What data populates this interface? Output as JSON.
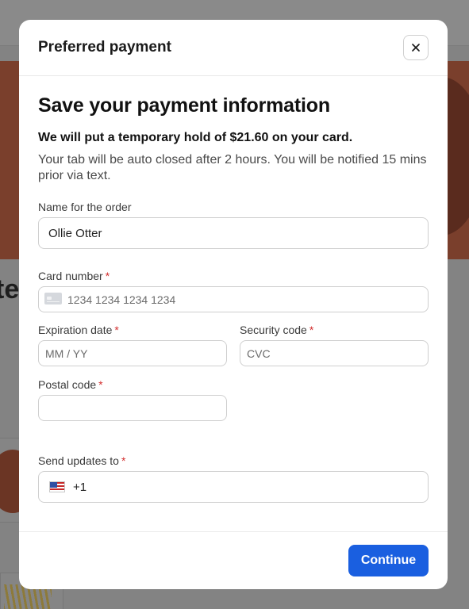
{
  "background": {
    "heading_fragment": "te"
  },
  "modal": {
    "title": "Preferred payment",
    "close_label": "Close",
    "heading": "Save your payment information",
    "hold_notice": "We will put a temporary hold of $21.60 on your card.",
    "info_text": "Your tab will be auto closed after 2 hours. You will be notified 15 mins prior via text.",
    "name_field": {
      "label": "Name for the order",
      "value": "Ollie Otter"
    },
    "card_number": {
      "label": "Card number",
      "required_mark": "*",
      "placeholder": "1234 1234 1234 1234",
      "icon": "credit-card-icon"
    },
    "expiration": {
      "label": "Expiration date",
      "required_mark": "*",
      "placeholder": "MM / YY"
    },
    "security_code": {
      "label": "Security code",
      "required_mark": "*",
      "placeholder": "CVC"
    },
    "postal_code": {
      "label": "Postal code",
      "required_mark": "*",
      "placeholder": ""
    },
    "send_updates": {
      "label": "Send updates to",
      "required_mark": "*",
      "value": "+1",
      "icon": "us-flag-icon"
    },
    "continue_label": "Continue"
  },
  "colors": {
    "accent": "#1a5fe0",
    "required": "#d32f2f",
    "overlay": "#838383"
  }
}
